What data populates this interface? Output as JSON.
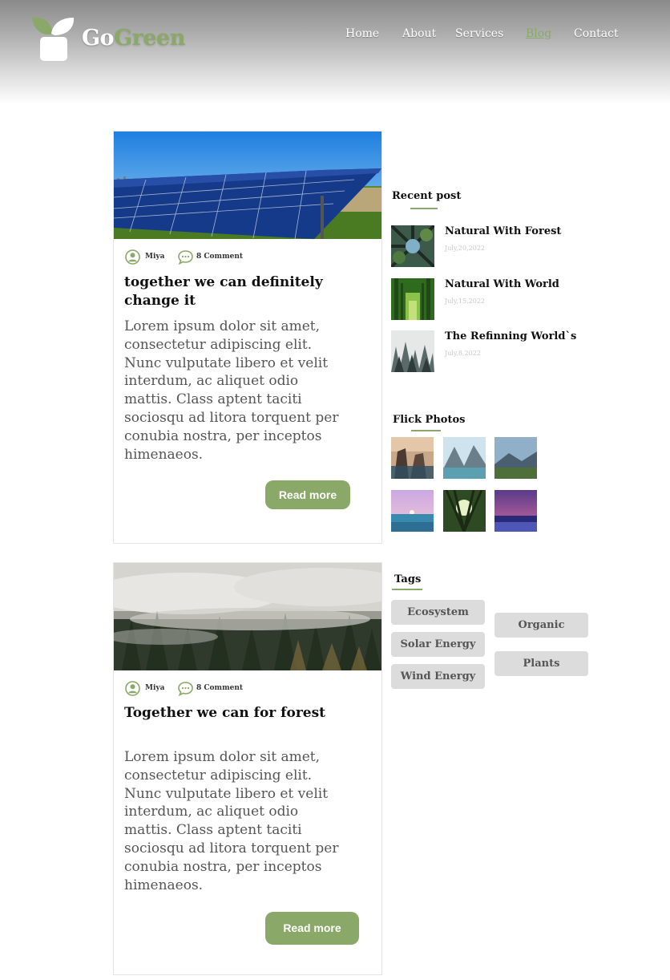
{
  "brand": {
    "part1": "Go",
    "part2": "Green"
  },
  "nav": {
    "items": [
      "Home",
      "About",
      "Services",
      "Blog",
      "Contact"
    ],
    "active": "Blog"
  },
  "posts": [
    {
      "author": "Miya",
      "comments": "8 Comment",
      "title": "together we can definitely change it",
      "body": "Lorem ipsum dolor sit amet, consectetur adipiscing elit. Nunc vulputate libero et velit interdum, ac aliquet odio mattis. Class aptent taciti sociosqu ad litora torquent per conubia nostra, per inceptos himenaeos.",
      "button": "Read more",
      "image": "solar-panels-image"
    },
    {
      "author": "Miya",
      "comments": "8 Comment",
      "title": "Together we can for forest",
      "body": "Lorem ipsum dolor sit amet, consectetur adipiscing elit. Nunc vulputate libero et velit interdum, ac aliquet odio mattis. Class aptent taciti sociosqu ad litora torquent per conubia nostra, per inceptos himenaeos.",
      "button": "Read more",
      "image": "misty-forest-image"
    }
  ],
  "recent": {
    "title": "Recent post",
    "items": [
      {
        "title": "Natural With Forest",
        "date": "July,20,2022"
      },
      {
        "title": "Natural With World",
        "date": "July,15,2022"
      },
      {
        "title": "The Refinning World`s",
        "date": "July,8,2022"
      }
    ]
  },
  "flick": {
    "title": "Flick Photos"
  },
  "tags": {
    "title": "Tags",
    "left": [
      "Ecosystem",
      "Solar Energy",
      "Wind Energy"
    ],
    "right": [
      "Organic",
      "Plants"
    ]
  },
  "colors": {
    "accent": "#8aa867",
    "tag_bg": "#dcdcdc",
    "text": "#111111"
  }
}
